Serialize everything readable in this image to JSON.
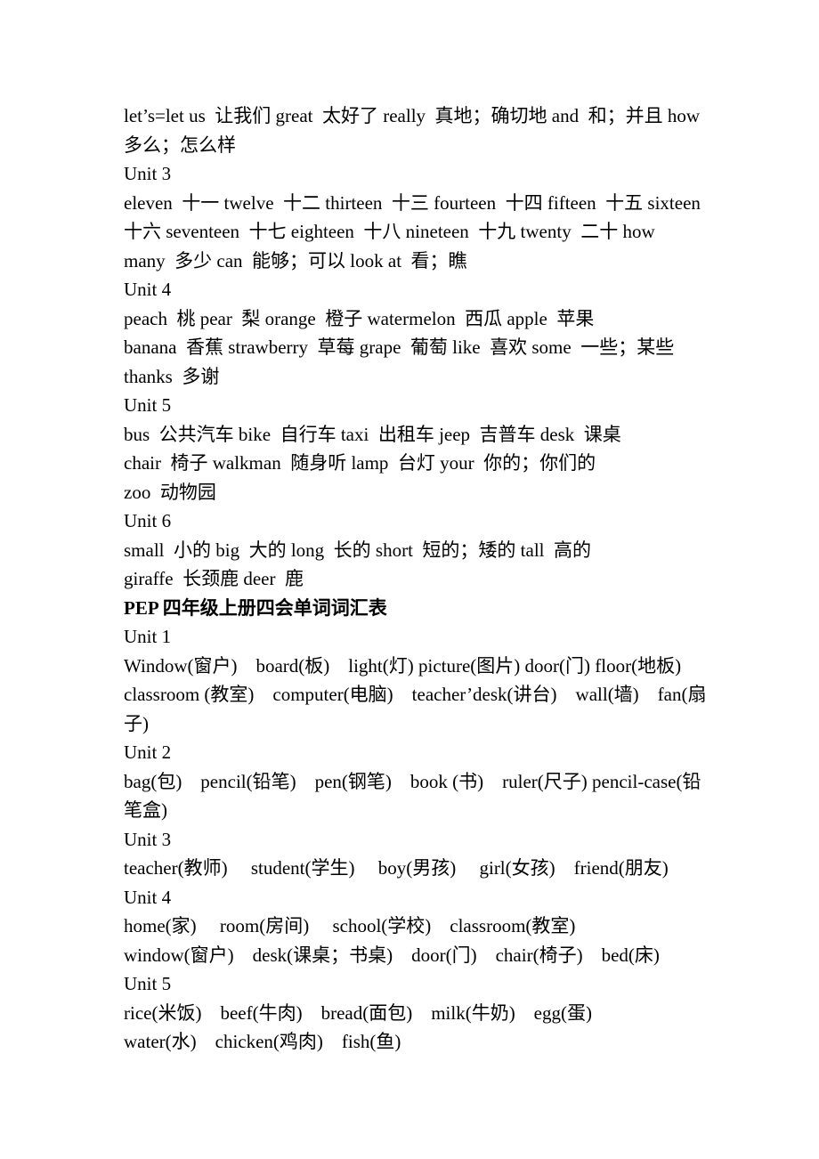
{
  "document": {
    "section1_lines": [
      "let’s=let us  让我们 great  太好了 really  真地；确切地 and  和；并且 how",
      "多么；怎么样"
    ],
    "unit3": {
      "heading": "Unit 3",
      "lines": [
        "eleven  十一 twelve  十二 thirteen  十三 fourteen  十四 fifteen  十五 sixteen",
        "十六 seventeen  十七 eighteen  十八 nineteen  十九 twenty  二十 how",
        "many  多少 can  能够；可以 look at  看；瞧"
      ]
    },
    "unit4": {
      "heading": "Unit 4",
      "lines": [
        "peach  桃 pear  梨 orange  橙子 watermelon  西瓜 apple  苹果",
        "banana  香蕉 strawberry  草莓 grape  葡萄 like  喜欢 some  一些；某些",
        "thanks  多谢"
      ]
    },
    "unit5": {
      "heading": "Unit 5",
      "lines": [
        "bus  公共汽车 bike  自行车 taxi  出租车 jeep  吉普车 desk  课桌",
        "chair  椅子 walkman  随身听 lamp  台灯 your  你的；你们的",
        "zoo  动物园"
      ]
    },
    "unit6": {
      "heading": "Unit 6",
      "lines": [
        "small  小的 big  大的 long  长的 short  短的；矮的 tall  高的",
        "giraffe  长颈鹿 deer  鹿"
      ]
    },
    "section_title": "PEP 四年级上册四会单词词汇表",
    "g4_unit1": {
      "heading": "Unit 1",
      "lines": [
        "Window(窗户)    board(板)    light(灯) picture(图片) door(门) floor(地板)",
        "classroom (教室)    computer(电脑)    teacher’desk(讲台)    wall(墙)    fan(扇",
        "子)"
      ]
    },
    "g4_unit2": {
      "heading": "Unit 2",
      "lines": [
        "bag(包)    pencil(铅笔)    pen(钢笔)    book (书)    ruler(尺子) pencil-case(铅",
        "笔盒)"
      ]
    },
    "g4_unit3": {
      "heading": "Unit 3",
      "lines": [
        "teacher(教师)     student(学生)     boy(男孩)     girl(女孩)    friend(朋友)"
      ]
    },
    "g4_unit4": {
      "heading": "Unit 4",
      "lines": [
        "home(家)     room(房间)     school(学校)    classroom(教室)",
        "window(窗户)    desk(课桌；书桌)    door(门)    chair(椅子)    bed(床)"
      ]
    },
    "g4_unit5": {
      "heading": "Unit 5",
      "lines": [
        "rice(米饭)    beef(牛肉)    bread(面包)    milk(牛奶)    egg(蛋)",
        "water(水)    chicken(鸡肉)    fish(鱼)"
      ]
    }
  }
}
